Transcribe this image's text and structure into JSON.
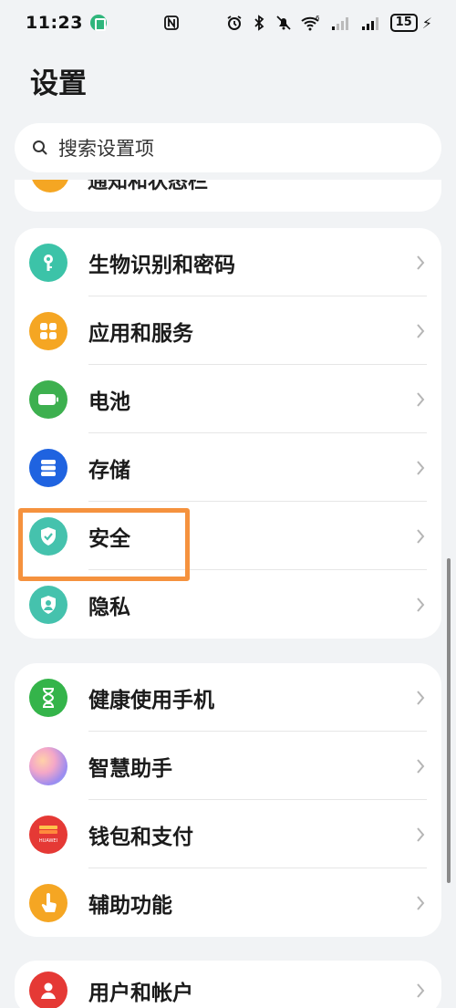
{
  "status_bar": {
    "time": "11:23",
    "battery": "15"
  },
  "page_title": "设置",
  "search": {
    "placeholder": "搜索设置项"
  },
  "partial_item": {
    "label": "通知和状态栏"
  },
  "groups": [
    {
      "items": [
        {
          "label": "生物识别和密码",
          "icon": "key-icon",
          "color": "#3cc3a8"
        },
        {
          "label": "应用和服务",
          "icon": "apps-grid-icon",
          "color": "#f5a623"
        },
        {
          "label": "电池",
          "icon": "battery-icon",
          "color": "#3db04f"
        },
        {
          "label": "存储",
          "icon": "storage-icon",
          "color": "#1f63e0"
        },
        {
          "label": "安全",
          "icon": "shield-check-icon",
          "color": "#45c2ad"
        },
        {
          "label": "隐私",
          "icon": "privacy-shield-icon",
          "color": "#45c2ad"
        }
      ]
    },
    {
      "items": [
        {
          "label": "健康使用手机",
          "icon": "hourglass-icon",
          "color": "#34b44a"
        },
        {
          "label": "智慧助手",
          "icon": "assistant-orb-icon",
          "color": "#b99cf2"
        },
        {
          "label": "钱包和支付",
          "icon": "wallet-icon",
          "color": "#e53935"
        },
        {
          "label": "辅助功能",
          "icon": "hand-touch-icon",
          "color": "#f5a623"
        }
      ]
    },
    {
      "items": [
        {
          "label": "用户和帐户",
          "icon": "user-icon",
          "color": "#e53935"
        }
      ]
    }
  ],
  "wallet_badge_text": "HUAWEI"
}
